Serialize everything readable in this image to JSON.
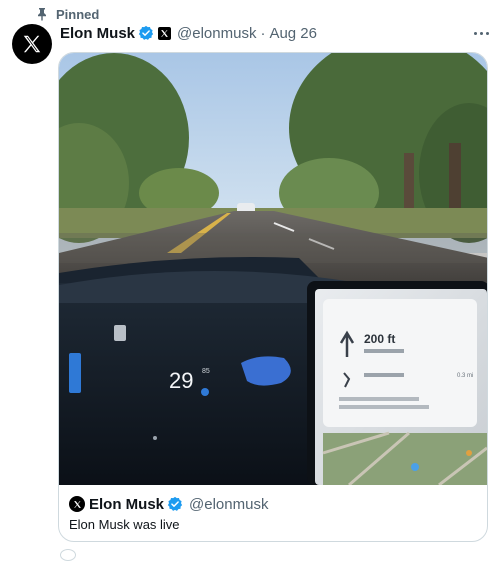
{
  "tweet": {
    "pinned_label": "Pinned",
    "author_name": "Elon Musk",
    "handle": "@elonmusk",
    "separator": "·",
    "timestamp": "Aug 26"
  },
  "quote": {
    "author_name": "Elon Musk",
    "handle": "@elonmusk",
    "text": "Elon Musk was live"
  },
  "video": {
    "speed": "29",
    "speed_limit": "85",
    "nav_distance": "200 ft",
    "nav_distance_2": "0.3 mi"
  },
  "colors": {
    "verified_blue": "#1d9bf0",
    "secondary_text": "#536471",
    "border": "#cfd9de"
  }
}
